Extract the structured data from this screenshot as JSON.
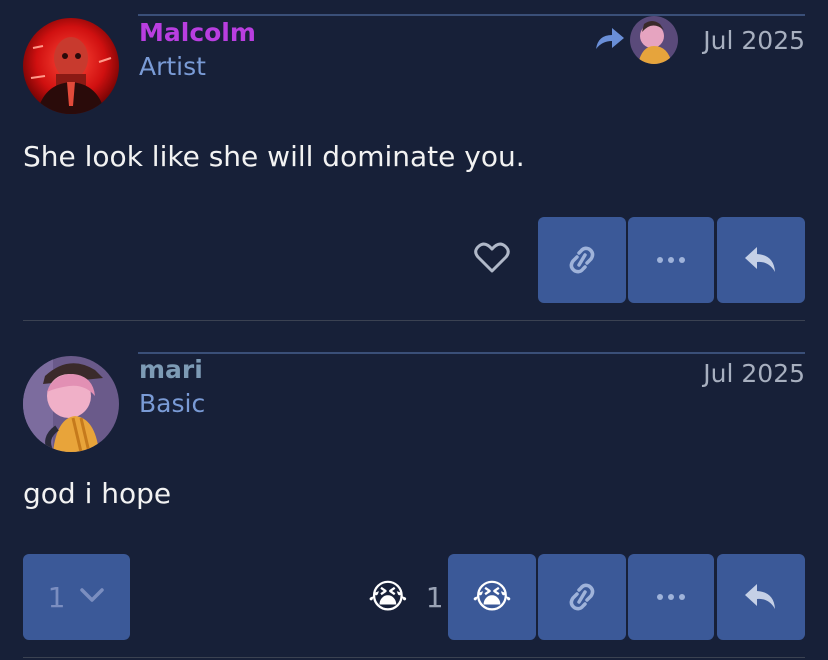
{
  "posts": [
    {
      "username": "Malcolm",
      "user_title": "Artist",
      "date": "Jul 2025",
      "body": "She look like she will dominate you.",
      "username_color": "#b93ee0"
    },
    {
      "username": "mari",
      "user_title": "Basic",
      "date": "Jul 2025",
      "body": "god i hope",
      "username_color": "#7d9bb5",
      "reaction_emoji": "😭",
      "reaction_count": "1",
      "replies_count": "1"
    }
  ],
  "icons": {
    "heart": "heart-icon",
    "link": "link-icon",
    "more": "ellipsis-icon",
    "reply": "reply-icon",
    "reply_to": "reply-to-arrow-icon",
    "expand": "chevron-down-icon"
  },
  "colors": {
    "background": "#172038",
    "button": "#3b5998",
    "user_title": "#7a9bd6",
    "divider": "#3b4252"
  }
}
